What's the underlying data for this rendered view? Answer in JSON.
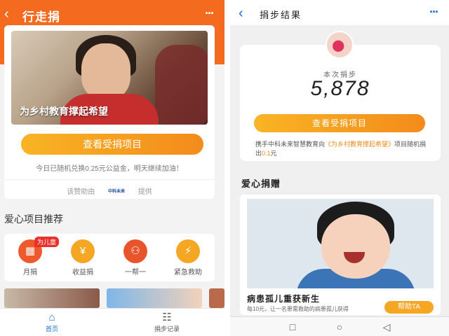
{
  "left": {
    "header": {
      "title": "行走捐"
    },
    "hero": {
      "caption": "为乡村教育撑起希望"
    },
    "cta_label": "查看受捐项目",
    "note": "今日已随机兑换0.25元公益金，明天继续加油！",
    "sponsor": {
      "prefix": "该赞助由",
      "logo_text": "中科未来",
      "suffix": "提供"
    },
    "section_title": "爱心项目推荐",
    "features": [
      {
        "label": "月捐",
        "icon": "calendar-icon",
        "badge": "为儿童"
      },
      {
        "label": "收益捐",
        "icon": "money-icon"
      },
      {
        "label": "一帮一",
        "icon": "people-icon"
      },
      {
        "label": "紧急救助",
        "icon": "lightning-icon"
      }
    ],
    "tabs": [
      {
        "label": "首页",
        "icon": "home-icon",
        "active": true
      },
      {
        "label": "捐步记录",
        "icon": "record-icon",
        "active": false
      }
    ],
    "colors": {
      "brand": "#f46b1f",
      "accent": "#f5a623",
      "active_tab": "#1b6fd8"
    }
  },
  "right": {
    "header": {
      "title": "捐步结果"
    },
    "result": {
      "label": "本次捐步",
      "steps": "5,878",
      "cta_label": "查看受捐项目",
      "desc_before": "携手中科未来智慧教育向",
      "desc_project": "《为乡村教育撑起希望》",
      "desc_middle": "项目随机捐出",
      "desc_amount": "0.1",
      "desc_unit": "元"
    },
    "section_title": "爱心捐赠",
    "project": {
      "title": "病患孤儿重获新生",
      "subtitle": "每10元，让一名患需救助的病患孤儿获得",
      "help_label": "帮助TA"
    },
    "nav": {
      "square": "□",
      "circle": "○",
      "back": "◁"
    }
  }
}
